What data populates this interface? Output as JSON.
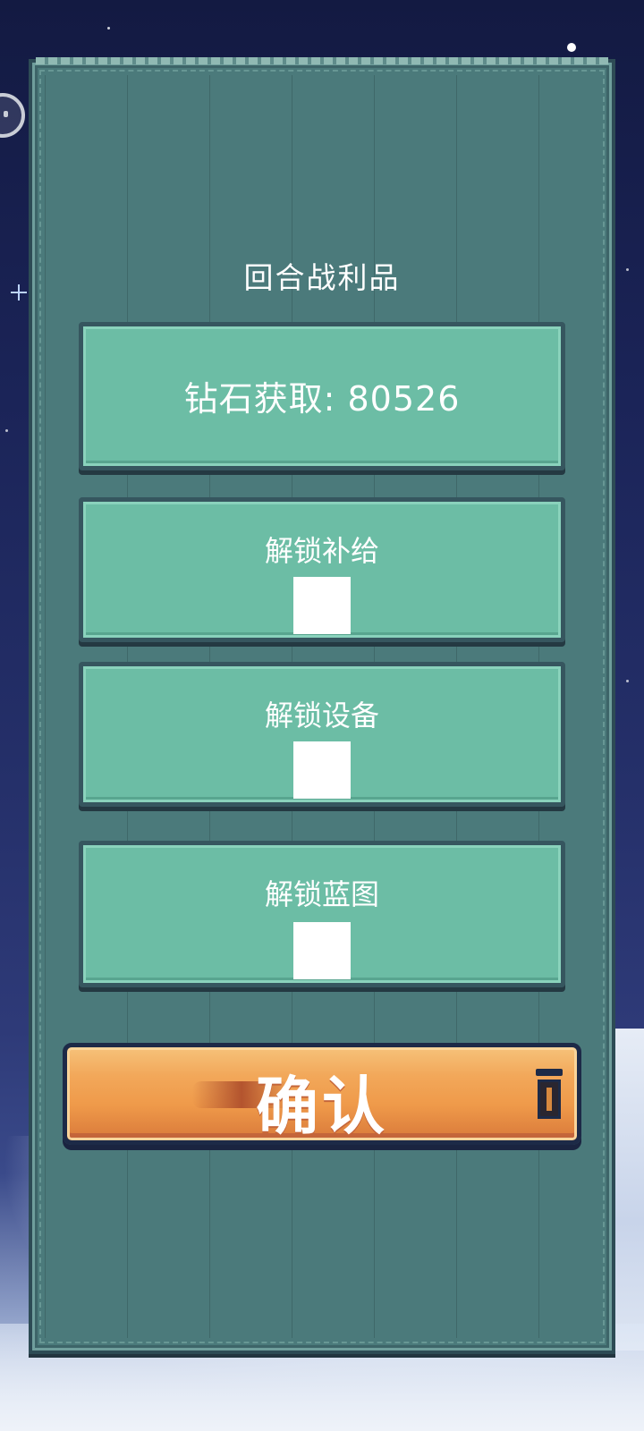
{
  "panel": {
    "title": "回合战利品"
  },
  "rewards": {
    "diamond_text": "钻石获取: 80526",
    "supply_label": "解锁补给",
    "device_label": "解锁设备",
    "blueprint_label": "解锁蓝图"
  },
  "confirm": {
    "label": "确认"
  },
  "colors": {
    "panel": "#4b7a7b",
    "card": "#6cbda5",
    "button": "#ef9a4a",
    "text": "#ffffff"
  },
  "icons": {
    "side_button": "ghost-face-icon",
    "button_trailing": "trash-can-icon",
    "sky_sparkle": "star-icon"
  }
}
